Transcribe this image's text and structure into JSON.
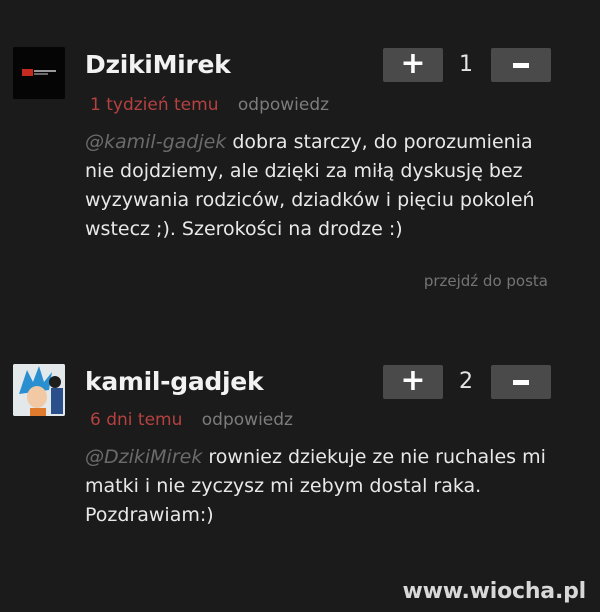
{
  "comments": [
    {
      "author": "DzikiMirek",
      "avatar_icon": "dark-logo-avatar-icon",
      "time": "1 tydzień temu",
      "reply_label": "odpowiedz",
      "score": "1",
      "plus_label": "+",
      "mention": "@kamil-gadjek",
      "text": " dobra starczy, do porozumienia nie dojdziemy, ale dzięki za miłą dyskusję bez wyzywania rodziców, dziadków i pięciu pokoleń wstecz ;). Szerokości na drodze :)",
      "goto_label": "przejdź do posta"
    },
    {
      "author": "kamil-gadjek",
      "avatar_icon": "anime-character-avatar-icon",
      "time": "6 dni temu",
      "reply_label": "odpowiedz",
      "score": "2",
      "plus_label": "+",
      "mention": "@DzikiMirek",
      "text": " rowniez dziekuje ze nie ruchales mi matki i nie zyczysz mi zebym dostal raka. Pozdrawiam:)"
    }
  ],
  "watermark": "www.wiocha.pl",
  "colors": {
    "background": "#1b1b1b",
    "time_red": "#b54141",
    "button_gray": "#4a4a4a",
    "muted": "#7c7c7c"
  }
}
